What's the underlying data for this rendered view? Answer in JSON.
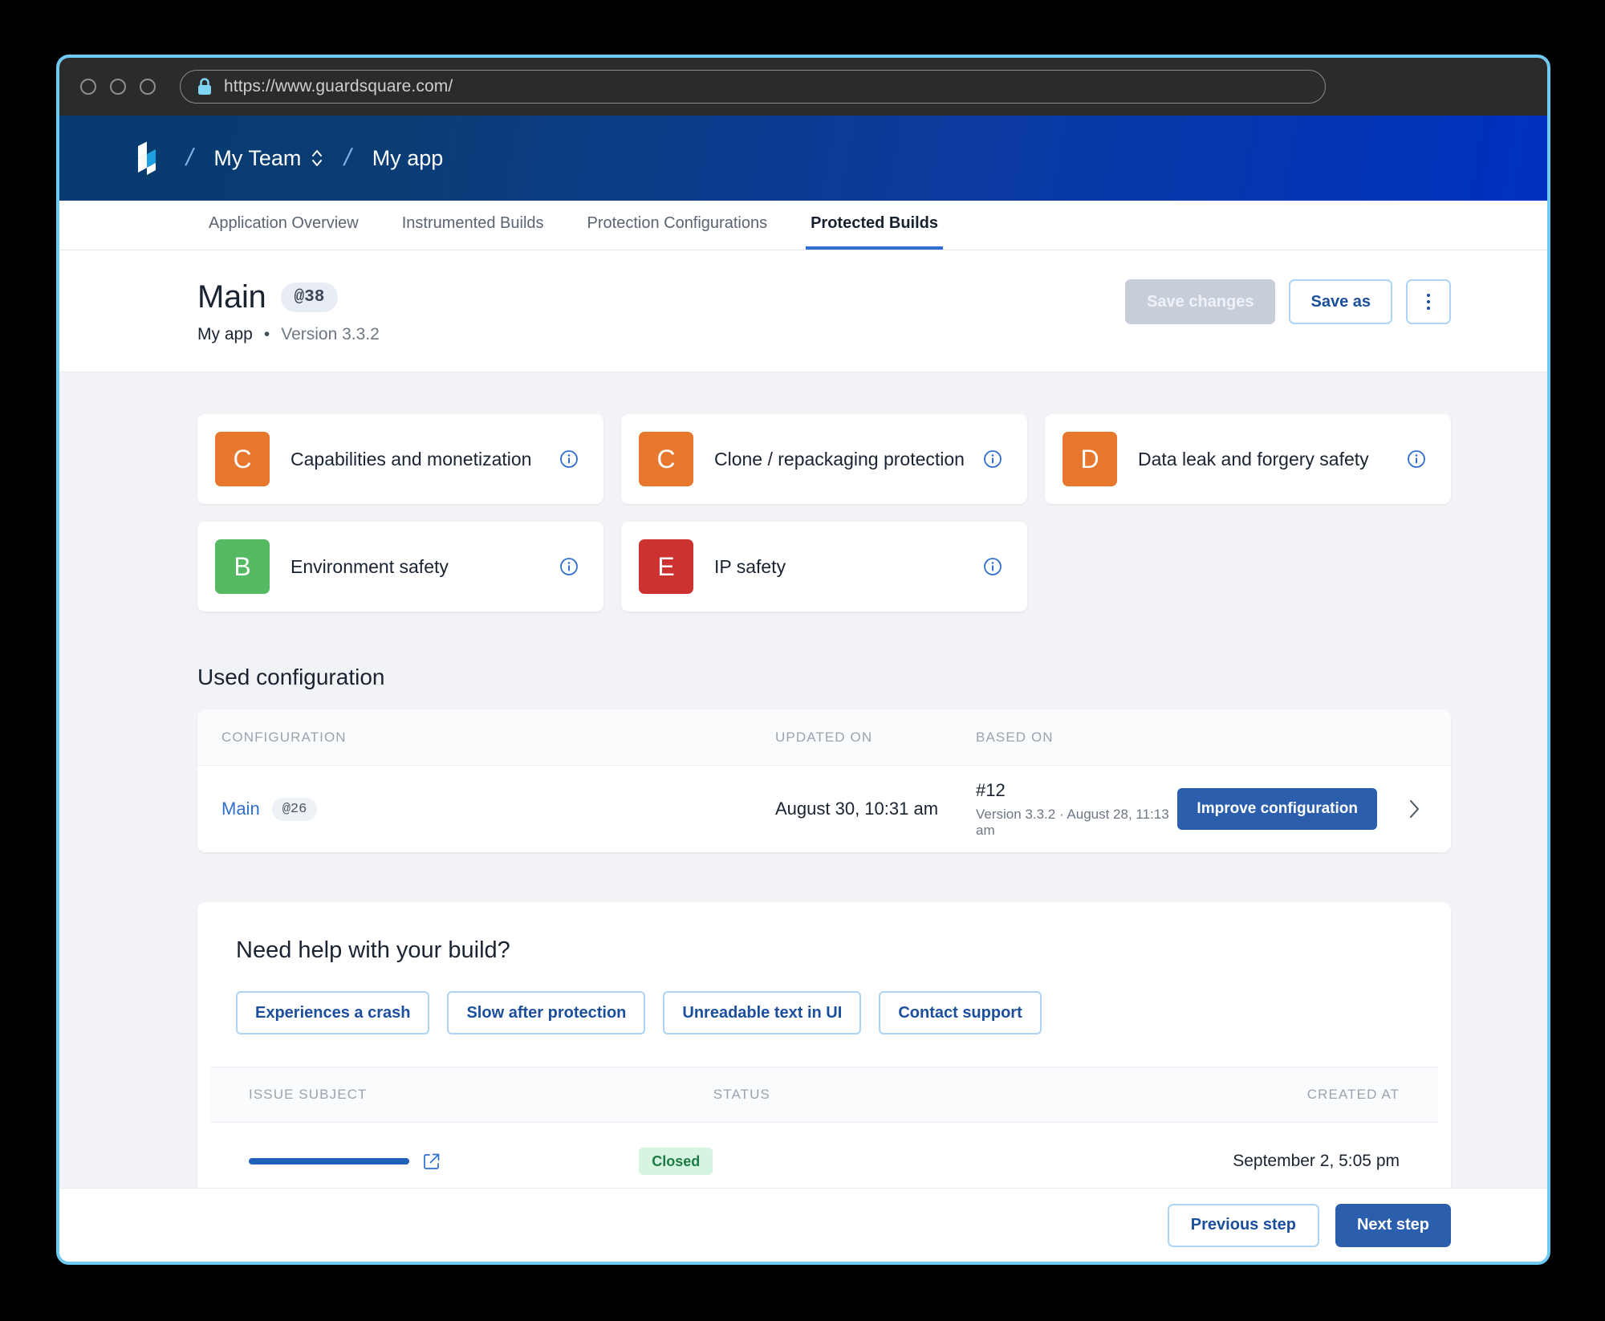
{
  "browser": {
    "url": "https://www.guardsquare.com/",
    "lock_icon": "lock-icon",
    "traffic_lights": [
      "close",
      "minimize",
      "maximize"
    ]
  },
  "appnav": {
    "logo_icon": "guardsquare-logo-icon",
    "separator": "/",
    "team": "My Team",
    "team_switcher_icon": "chevron-up-down-icon",
    "app": "My app"
  },
  "tabs": [
    {
      "label": "Application Overview",
      "active": false
    },
    {
      "label": "Instrumented Builds",
      "active": false
    },
    {
      "label": "Protection Configurations",
      "active": false
    },
    {
      "label": "Protected Builds",
      "active": true
    }
  ],
  "header": {
    "title": "Main",
    "version_pill": "@38",
    "app_name": "My app",
    "bullet": "•",
    "version": "Version 3.3.2",
    "save_changes_label": "Save changes",
    "save_as_label": "Save as",
    "kebab_icon": "more-vertical-icon"
  },
  "protection_cards": [
    {
      "grade": "C",
      "color": "#e8772e",
      "label": "Capabilities and monetization",
      "info_icon": "info-circle-icon"
    },
    {
      "grade": "C",
      "color": "#e8772e",
      "label": "Clone / repackaging protection",
      "info_icon": "info-circle-icon"
    },
    {
      "grade": "D",
      "color": "#e8772e",
      "label": "Data leak and forgery safety",
      "info_icon": "info-circle-icon"
    },
    {
      "grade": "B",
      "color": "#55b863",
      "label": "Environment safety",
      "info_icon": "info-circle-icon"
    },
    {
      "grade": "E",
      "color": "#cc3330",
      "label": "IP safety",
      "info_icon": "info-circle-icon"
    }
  ],
  "used_configuration": {
    "section_title": "Used configuration",
    "columns": {
      "configuration": "CONFIGURATION",
      "updated_on": "UPDATED ON",
      "based_on": "BASED ON"
    },
    "row": {
      "config_name": "Main",
      "config_pill": "@26",
      "updated_on": "August 30, 10:31 am",
      "based_on_build": "#12",
      "based_on_detail": "Version 3.3.2 · August 28, 11:13 am",
      "improve_label": "Improve configuration",
      "chevron_icon": "chevron-right-icon"
    }
  },
  "help": {
    "title": "Need help with your build?",
    "chips": [
      "Experiences a crash",
      "Slow after protection",
      "Unreadable text in UI",
      "Contact support"
    ],
    "columns": {
      "subject": "ISSUE SUBJECT",
      "status": "STATUS",
      "created": "CREATED AT"
    },
    "rows": [
      {
        "subject_redacted": true,
        "external_link_icon": "external-link-icon",
        "status": "Closed",
        "created_at": "September 2, 5:05 pm"
      }
    ]
  },
  "footer": {
    "previous_label": "Previous step",
    "next_label": "Next step"
  },
  "colors": {
    "accent_blue": "#2b5fad",
    "link_blue": "#2f6fd0",
    "window_border": "#6dcaf0",
    "nav_gradient_start": "#073a6e",
    "nav_gradient_end": "#0030bf",
    "page_bg": "#f1f3f6",
    "status_closed_bg": "#d6f5e0",
    "status_closed_fg": "#1d7a45"
  }
}
